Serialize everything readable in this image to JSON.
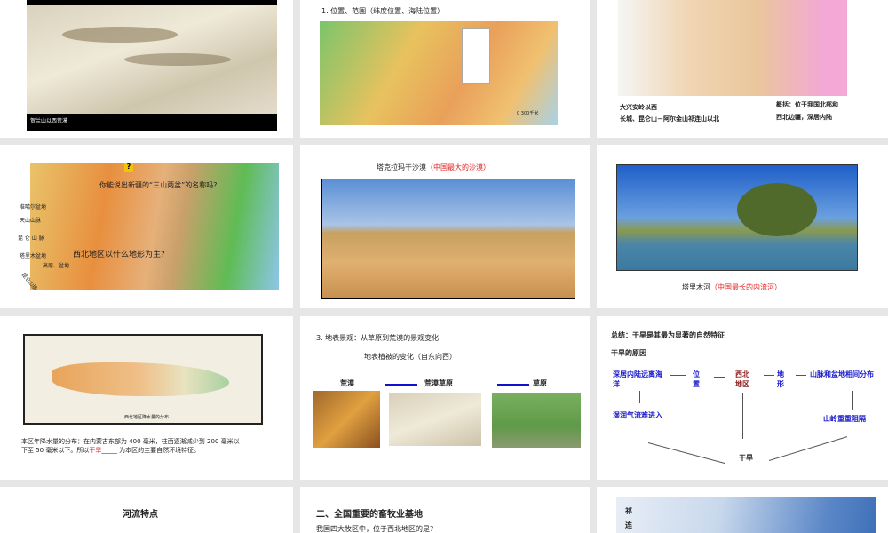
{
  "slides": [
    {
      "caption": "贺兰山以西荒漠"
    },
    {
      "title": "1. 位置、范围（纬度位置、海陆位置）",
      "scale": "0   300千米"
    },
    {
      "left1": "大兴安岭以西",
      "left2": "长城、昆仑山－阿尔金山祁连山以北",
      "right1": "概括：位于我国北部和",
      "right2": "西北边疆，深居内陆"
    },
    {
      "q1": "你能说出新疆的“三山两盆”的名称吗?",
      "q2": "西北地区以什么地形为主?",
      "labels": [
        "准噶尔盆地",
        "天山山脉",
        "昆 仑 山 脉",
        "塔里木盆地",
        "高原、盆地",
        "昆仑山脉"
      ],
      "qmark": "?"
    },
    {
      "title": "塔克拉玛干沙漠",
      "note": "（中国最大的沙漠）"
    },
    {
      "title": "塔里木河",
      "note": "（中国最长的内流河）"
    },
    {
      "map_caption": "西北地区降水量的分布",
      "line1": "本区年降水量的分布：在内蒙古东部为 400 毫米，往西逐渐减少到 200 毫米以",
      "line2a": "下至 50 毫米以下。所以",
      "answer": "干旱",
      "line2b": "_____ 为本区的主要自然环境特征。"
    },
    {
      "title": "3. 地表景观：从草原到荒漠的景观变化",
      "subtitle": "地表植被的变化（自东向西）",
      "labels": [
        "荒漠",
        "荒漠草原",
        "草原"
      ]
    },
    {
      "summary": "总结：干旱是其最为显著的自然特征",
      "reason": "干旱的原因",
      "n1": "深居内陆远离海洋",
      "n2": "位置",
      "n3": "西北地区",
      "n4": "地形",
      "n5": "山脉和盆地相间分布",
      "n6": "湿润气流难进入",
      "n7": "山岭重重阻隔",
      "result": "干旱"
    },
    {
      "title": "河流特点"
    },
    {
      "title": "二、全国重要的畜牧业基地",
      "q": "我国四大牧区中，位于西北地区的是?"
    },
    {
      "side": [
        "祁",
        "连"
      ]
    }
  ]
}
